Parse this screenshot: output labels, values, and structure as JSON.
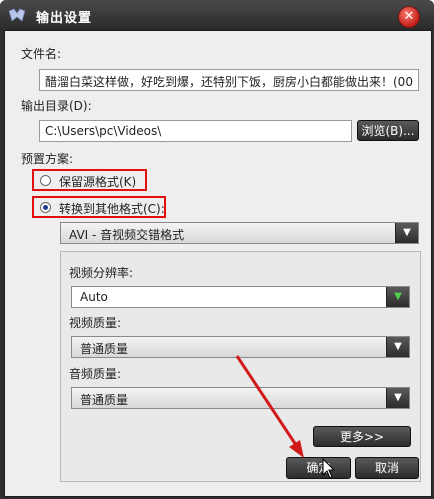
{
  "window": {
    "title": "输出设置",
    "close_symbol": "✕"
  },
  "filename": {
    "label": "文件名:",
    "value": "醋溜白菜这样做，好吃到爆，还特别下饭，厨房小白都能做出来！(00"
  },
  "output_dir": {
    "label": "输出目录(D):",
    "value": "C:\\Users\\pc\\Videos\\",
    "browse_label": "浏览(B)..."
  },
  "preset": {
    "label": "预置方案:",
    "keep_source_label": "保留源格式(K)",
    "convert_label": "转换到其他格式(C):",
    "selected": "convert",
    "format_value": "AVI - 音视频交错格式"
  },
  "video": {
    "resolution_label": "视频分辨率:",
    "resolution_value": "Auto",
    "quality_label": "视频质量:",
    "quality_value": "普通质量"
  },
  "audio": {
    "quality_label": "音频质量:",
    "quality_value": "普通质量"
  },
  "buttons": {
    "more_label": "更多>>",
    "ok_label": "确定",
    "cancel_label": "取消"
  },
  "colors": {
    "highlight": "#e01010",
    "annotation_arrow": "#d11a1a",
    "title_bar": "#2e2e2e"
  },
  "icons": {
    "dropdown": "triangle-down",
    "close": "close-x",
    "cursor": "arrow-pointer"
  }
}
